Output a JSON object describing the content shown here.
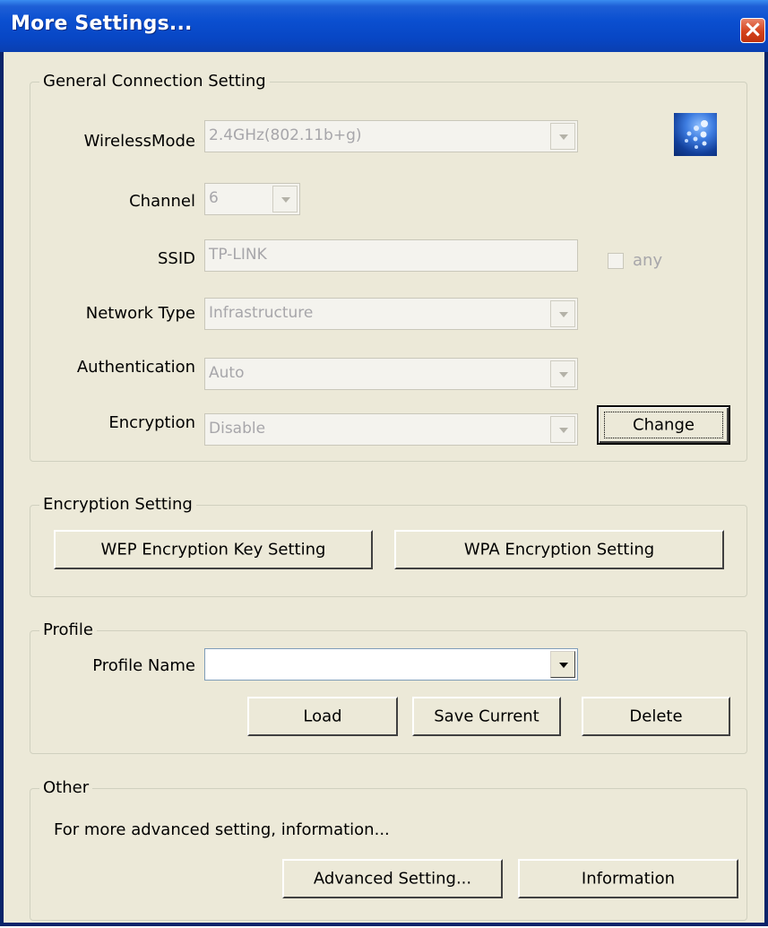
{
  "window": {
    "title": "More Settings...",
    "close_symbol": "×"
  },
  "general": {
    "group_title": "General Connection Setting",
    "wireless_mode": {
      "label": "WirelessMode",
      "value": "2.4GHz(802.11b+g)"
    },
    "channel": {
      "label": "Channel",
      "value": "6"
    },
    "ssid": {
      "label": "SSID",
      "value": "TP-LINK",
      "any_label": "any",
      "any_checked": false
    },
    "network_type": {
      "label": "Network Type",
      "value": "Infrastructure"
    },
    "authentication": {
      "label": "Authentication",
      "value": "Auto"
    },
    "encryption": {
      "label": "Encryption",
      "value": "Disable"
    },
    "change_label": "Change"
  },
  "encryption_setting": {
    "group_title": "Encryption Setting",
    "wep_label": "WEP Encryption Key Setting",
    "wpa_label": "WPA Encryption Setting"
  },
  "profile": {
    "group_title": "Profile",
    "name_label": "Profile Name",
    "name_value": "",
    "load_label": "Load",
    "save_label": "Save Current",
    "delete_label": "Delete"
  },
  "other": {
    "group_title": "Other",
    "description": "For more advanced setting, information...",
    "advanced_label": "Advanced Setting...",
    "information_label": "Information"
  },
  "icons": {
    "close": "close-icon",
    "logo": "wireless-adapter-logo-icon",
    "dropdown": "chevron-down-icon"
  },
  "colors": {
    "titlebar": "#0a4fd0",
    "dialog_bg": "#ece9d8",
    "disabled_text": "#a7a6aa",
    "close_button": "#d4421c"
  }
}
